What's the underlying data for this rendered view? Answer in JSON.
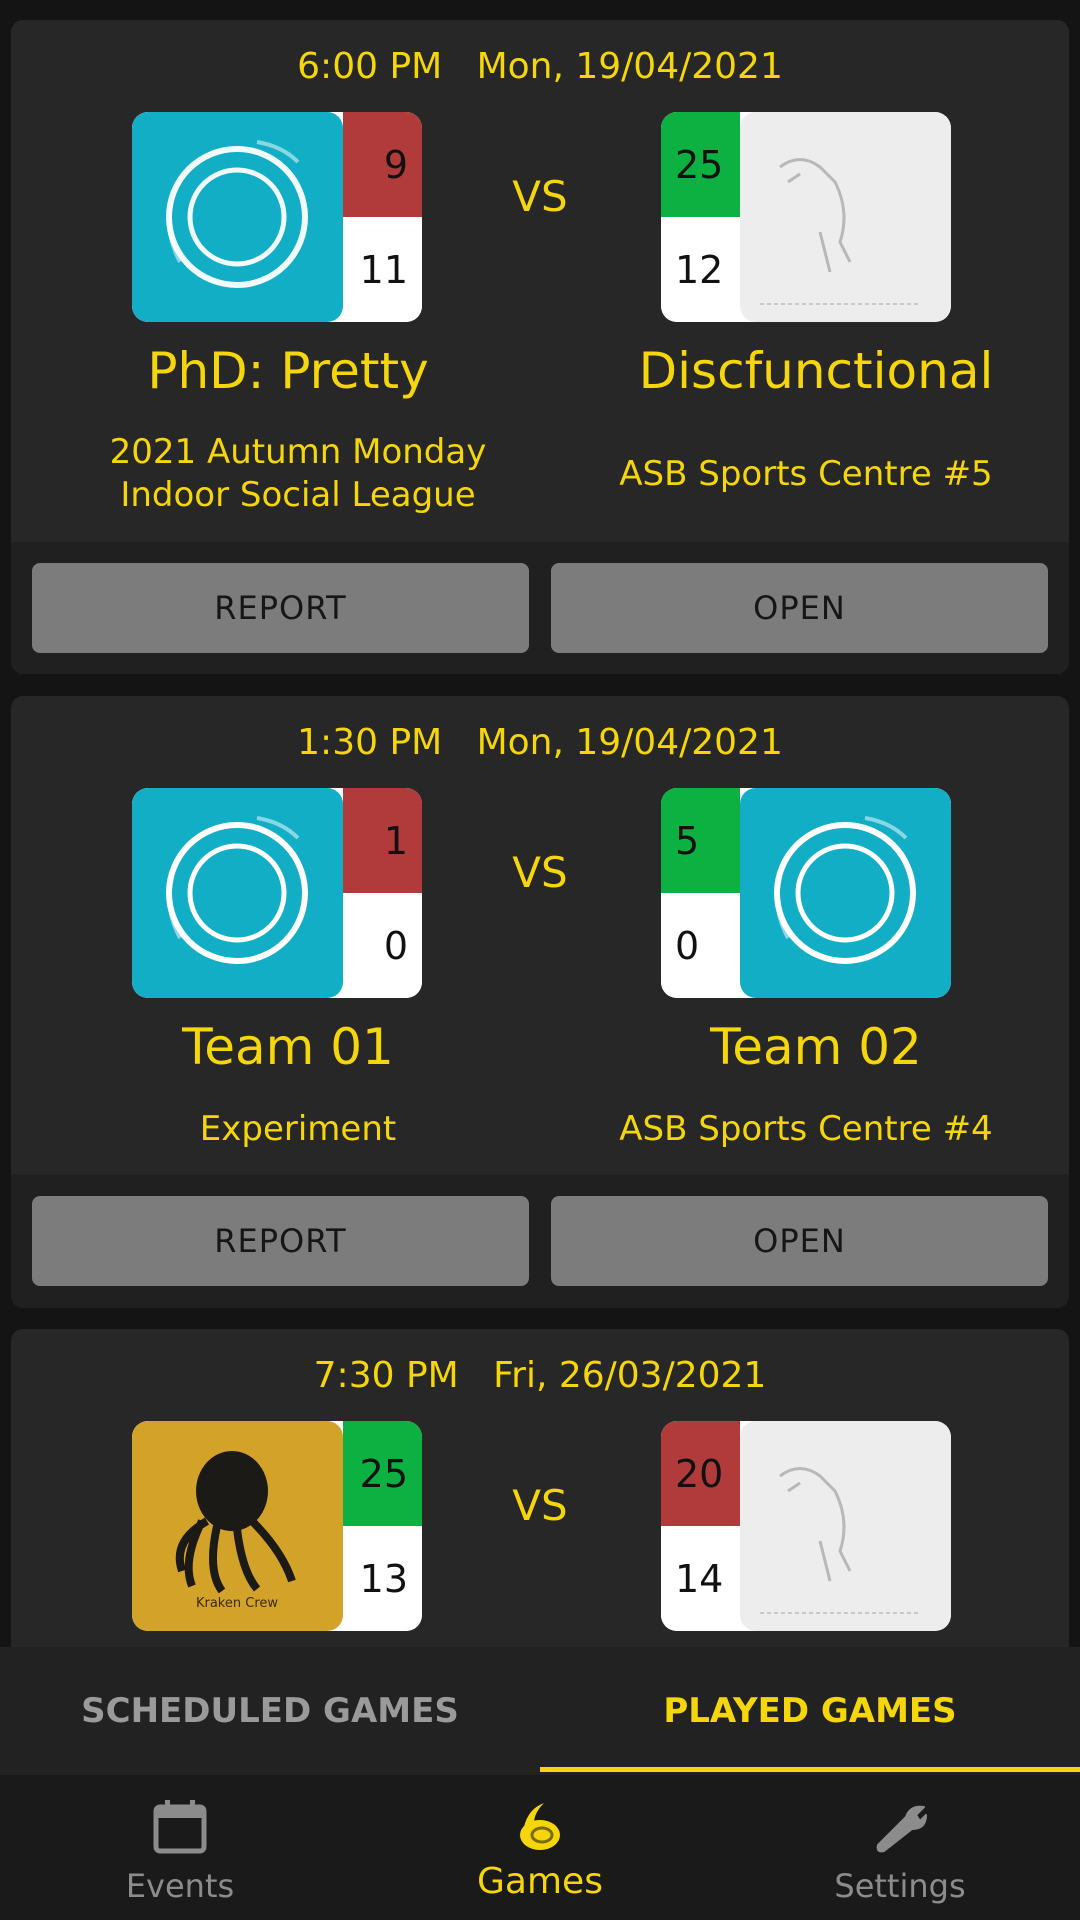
{
  "colors": {
    "accent": "#f5d60c",
    "win": "#0db142",
    "lose": "#b13b3b",
    "button": "#7c7c7c"
  },
  "vs_label": "VS",
  "games": [
    {
      "time": "6:00 PM",
      "date": "Mon, 19/04/2021",
      "home": {
        "name": "PhD: Pretty",
        "score_top": "9",
        "score_bottom": "11",
        "logo": "ring-logo"
      },
      "away": {
        "name": "Discfunctional",
        "score_top": "25",
        "score_bottom": "12",
        "logo": "dinosaur-sketch-logo"
      },
      "league_line1": "2021 Autumn Monday",
      "league_line2": "Indoor Social League",
      "venue": "ASB Sports Centre #5",
      "report_label": "REPORT",
      "open_label": "OPEN"
    },
    {
      "time": "1:30 PM",
      "date": "Mon, 19/04/2021",
      "home": {
        "name": "Team 01",
        "score_top": "1",
        "score_bottom": "0",
        "logo": "ring-logo"
      },
      "away": {
        "name": "Team 02",
        "score_top": "5",
        "score_bottom": "0",
        "logo": "ring-logo"
      },
      "league_line1": "Experiment",
      "venue": "ASB Sports Centre #4",
      "report_label": "REPORT",
      "open_label": "OPEN"
    },
    {
      "time": "7:30 PM",
      "date": "Fri, 26/03/2021",
      "home": {
        "score_top": "25",
        "score_bottom": "13",
        "logo": "octopus-logo",
        "logo_caption": "Kraken Crew"
      },
      "away": {
        "score_top": "20",
        "score_bottom": "14",
        "logo": "dinosaur-sketch-logo"
      }
    }
  ],
  "tabs": {
    "scheduled": "SCHEDULED GAMES",
    "played": "PLAYED GAMES",
    "active": "played"
  },
  "nav": {
    "items": [
      {
        "label": "Events",
        "icon": "calendar-icon"
      },
      {
        "label": "Games",
        "icon": "disc-icon"
      },
      {
        "label": "Settings",
        "icon": "wrench-icon"
      }
    ],
    "active": "Games"
  }
}
